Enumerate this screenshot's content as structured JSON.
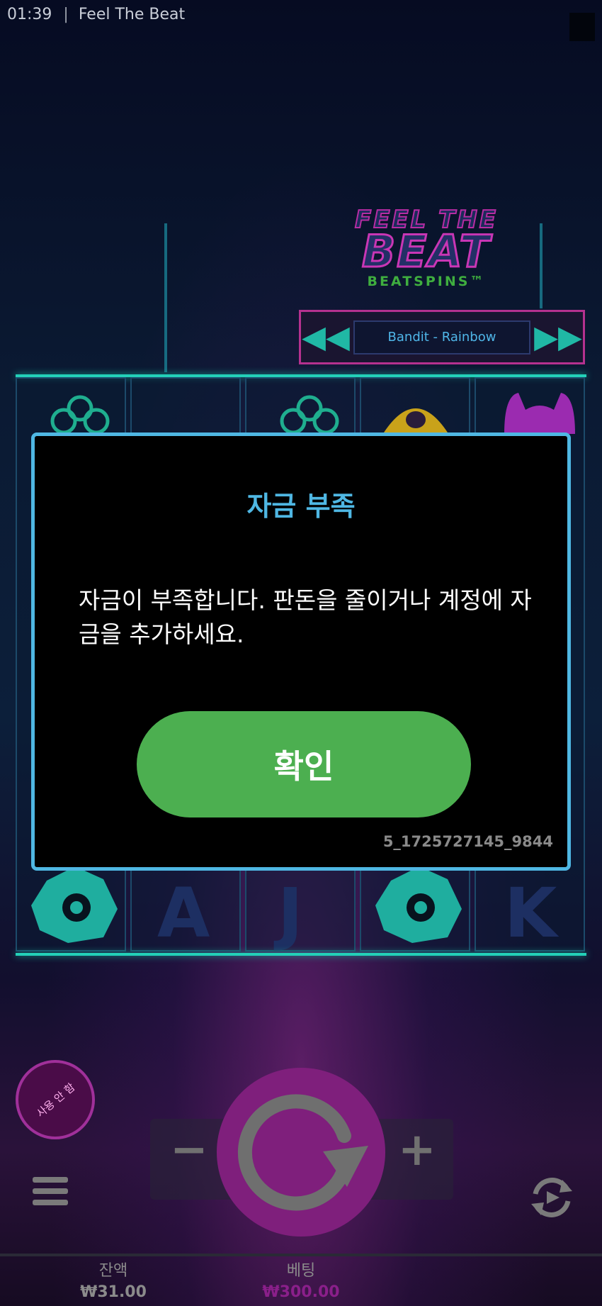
{
  "status_bar": {
    "time": "01:39",
    "separator": "|",
    "app_title": "Feel The Beat"
  },
  "logo": {
    "line1": "FEEL THE",
    "line2": "BEAT",
    "line3": "BEATSPINS™"
  },
  "track_selector": {
    "prev_icon": "rewind-icon",
    "current": "Bandit - Rainbow",
    "next_icon": "fast-forward-icon"
  },
  "reel_symbols": [
    {
      "icon": "clover-symbol",
      "color": "#1fae8f"
    },
    {
      "icon": "letter-a-symbol",
      "text": "A",
      "color": "#1d2f62"
    },
    {
      "icon": "letter-j-symbol",
      "text": "J",
      "color": "#1d2f62"
    },
    {
      "icon": "letter-k-symbol",
      "text": "K",
      "color": "#1d2f62"
    },
    {
      "icon": "monster-symbol",
      "color": "#9b2bb0"
    },
    {
      "icon": "spiky-creature-symbol",
      "color": "#1fae9f"
    }
  ],
  "dialog": {
    "title": "자금 부족",
    "message": "자금이 부족합니다. 판돈을 줄이거나 계정에 자금을 추가하세요.",
    "confirm_label": "확인",
    "code": "5_1725727145_9844"
  },
  "autoplay_badge": "사용 안 함",
  "controls": {
    "minus": "−",
    "plus": "+",
    "spin_icon": "spin-icon",
    "menu_icon": "menu-icon",
    "turbo_icon": "turbo-icon"
  },
  "footer": {
    "balance_label": "잔액",
    "balance_value": "₩31.00",
    "bet_label": "베팅",
    "bet_value": "₩300.00"
  },
  "colors": {
    "accent": "#4fb7e3",
    "confirm": "#4caf50",
    "spin": "#7f1f7c",
    "bet_value": "#8a1f8a"
  }
}
